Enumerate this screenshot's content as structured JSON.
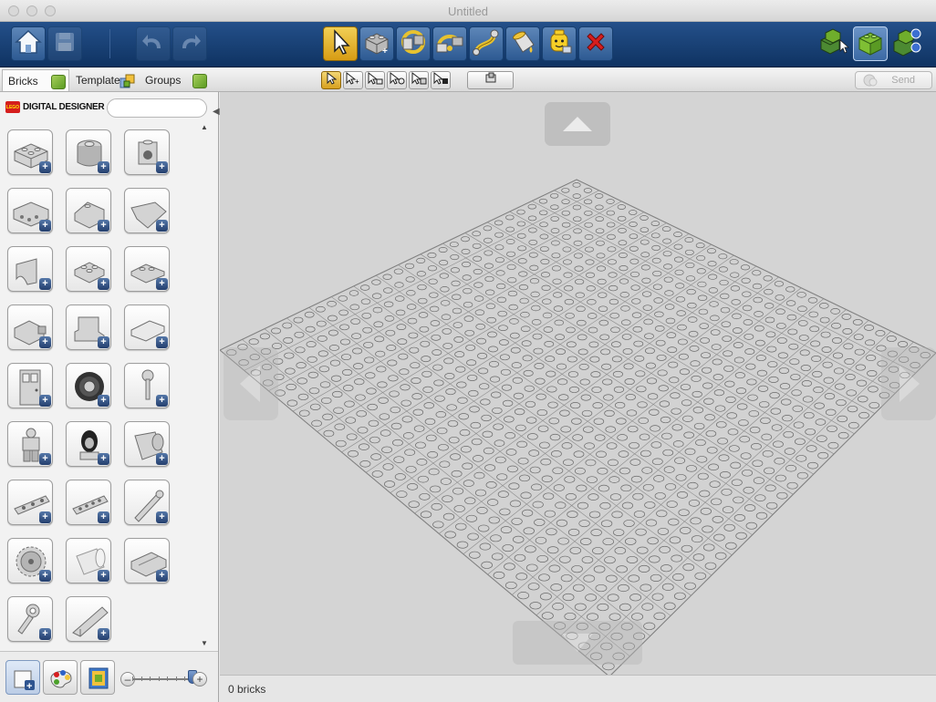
{
  "window": {
    "title": "Untitled"
  },
  "toolbar": {
    "left_buttons": [
      {
        "icon": "home-icon",
        "state": "active"
      },
      {
        "icon": "save-icon",
        "state": "disabled"
      },
      {
        "icon": "undo-icon",
        "state": "disabled"
      },
      {
        "icon": "redo-icon",
        "state": "disabled"
      }
    ],
    "tools": [
      {
        "icon": "select-cursor-icon",
        "state": "selected"
      },
      {
        "icon": "clone-brick-icon",
        "state": "normal"
      },
      {
        "icon": "hinge-tool-icon",
        "state": "normal"
      },
      {
        "icon": "hinge-align-tool-icon",
        "state": "normal"
      },
      {
        "icon": "flex-tool-icon",
        "state": "normal"
      },
      {
        "icon": "paint-bucket-icon",
        "state": "normal"
      },
      {
        "icon": "decoration-tool-icon",
        "state": "normal"
      },
      {
        "icon": "delete-x-icon",
        "state": "normal"
      }
    ],
    "modes": [
      {
        "icon": "build-mode-icon",
        "state": "normal"
      },
      {
        "icon": "view-mode-icon",
        "state": "selected"
      },
      {
        "icon": "building-guide-mode-icon",
        "state": "normal"
      }
    ]
  },
  "tabs": [
    {
      "label": "Bricks",
      "icon": "brick-cube-icon",
      "active": true
    },
    {
      "label": "Templates",
      "icon": "templates-icon",
      "active": false
    },
    {
      "label": "Groups",
      "icon": "groups-cube-icon",
      "active": false
    }
  ],
  "selection_tools": [
    {
      "icon": "single-select-icon",
      "selected": true
    },
    {
      "icon": "multi-select-icon",
      "selected": false
    },
    {
      "icon": "connected-select-icon",
      "selected": false
    },
    {
      "icon": "color-select-icon",
      "selected": false
    },
    {
      "icon": "shape-select-icon",
      "selected": false
    },
    {
      "icon": "invert-select-icon",
      "selected": false
    }
  ],
  "align_tool": {
    "icon": "align-icon"
  },
  "send_button": {
    "label": "Send"
  },
  "palette": {
    "brand_mark": "LEGO",
    "brand_text": "DIGITAL DESIGNER",
    "search": {
      "value": "",
      "placeholder": ""
    },
    "bricks": [
      "brick-2x3",
      "round-brick",
      "brick-with-knob",
      "technic-brick",
      "slope-brick",
      "wedge-slope",
      "arch-brick",
      "plate-2x2",
      "corner-plate",
      "brick-with-clip",
      "seat-piece",
      "wedge-plate",
      "door-piece",
      "wheel-tire",
      "antenna-piece",
      "minifigure",
      "minifig-head",
      "technic-gear-cylinder",
      "technic-beam",
      "technic-liftarm",
      "technic-axle",
      "technic-gear",
      "transparent-cylinder",
      "curved-panel",
      "wrench-tool",
      "ramp-piece"
    ]
  },
  "bottom_bar": {
    "buttons": [
      {
        "icon": "add-brick-icon",
        "state": "selected"
      },
      {
        "icon": "color-palette-icon",
        "state": "normal"
      },
      {
        "icon": "template-book-icon",
        "state": "normal"
      }
    ],
    "zoom_level": 0.85
  },
  "viewport": {
    "grid_size": 32,
    "background_color": "#d4d4d4"
  },
  "status": {
    "text": "0 bricks"
  },
  "colors": {
    "toolbar_blue": "#1b4377",
    "selected_gold": "#e3b131",
    "brick_green": "#6fae2c",
    "lego_red": "#d51d1d"
  }
}
